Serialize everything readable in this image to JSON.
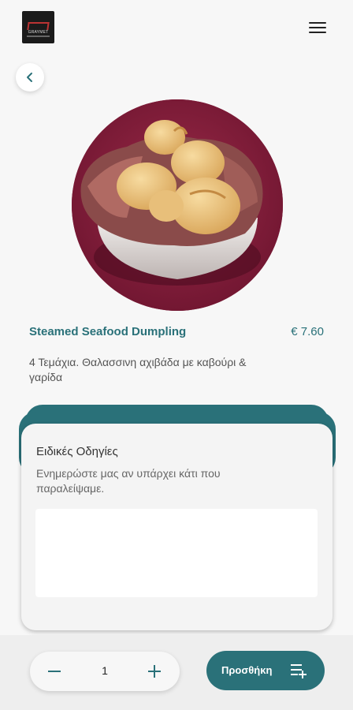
{
  "header": {
    "logo_text": "GRAYMET",
    "logo_icon": "logo-icon",
    "menu_icon": "hamburger-menu-icon"
  },
  "nav": {
    "back_icon": "chevron-left-icon"
  },
  "product": {
    "name": "Steamed Seafood Dumpling",
    "price": "€ 7.60",
    "description": "4 Τεμάχια. Θαλασσινη αχιβάδα με καβούρι & γαρίδα"
  },
  "instructions": {
    "title": "Ειδικές Οδηγίες",
    "subtitle": "Ενημερώστε μας αν υπάρχει κάτι που παραλείψαμε.",
    "value": "",
    "placeholder": ""
  },
  "quantity": {
    "value": "1",
    "minus_icon": "minus-icon",
    "plus_icon": "plus-icon"
  },
  "add_button": {
    "label": "Προσθήκη",
    "icon": "playlist-add-icon"
  },
  "colors": {
    "accent": "#2a7179",
    "plate_background": "#8a1c3c",
    "page_background": "#f7f7f7"
  }
}
